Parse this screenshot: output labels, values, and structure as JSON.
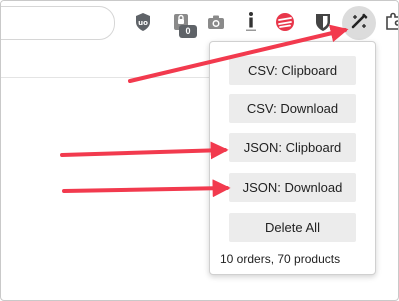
{
  "toolbar": {
    "extensions": [
      {
        "icon": "ublock-origin-icon",
        "badge": ""
      },
      {
        "icon": "lock-extension-icon",
        "badge": "0"
      },
      {
        "icon": "camera-icon",
        "badge": ""
      },
      {
        "icon": "info-extension-icon",
        "badge": ""
      },
      {
        "icon": "red-circle-extension-icon",
        "badge": ""
      },
      {
        "icon": "bitwarden-shield-icon",
        "badge": ""
      },
      {
        "icon": "order-exporter-icon",
        "badge": ""
      },
      {
        "icon": "puzzle-piece-icon",
        "badge": ""
      }
    ]
  },
  "popup": {
    "buttons": {
      "csv_clipboard": "CSV: Clipboard",
      "csv_download": "CSV: Download",
      "json_clipboard": "JSON: Clipboard",
      "json_download": "JSON: Download",
      "delete_all": "Delete All"
    },
    "summary": "10 orders, 70 products"
  },
  "colors": {
    "arrow": "#f23a4e",
    "button_bg": "#ececec",
    "toolbar_highlight": "#dcdcdc"
  }
}
